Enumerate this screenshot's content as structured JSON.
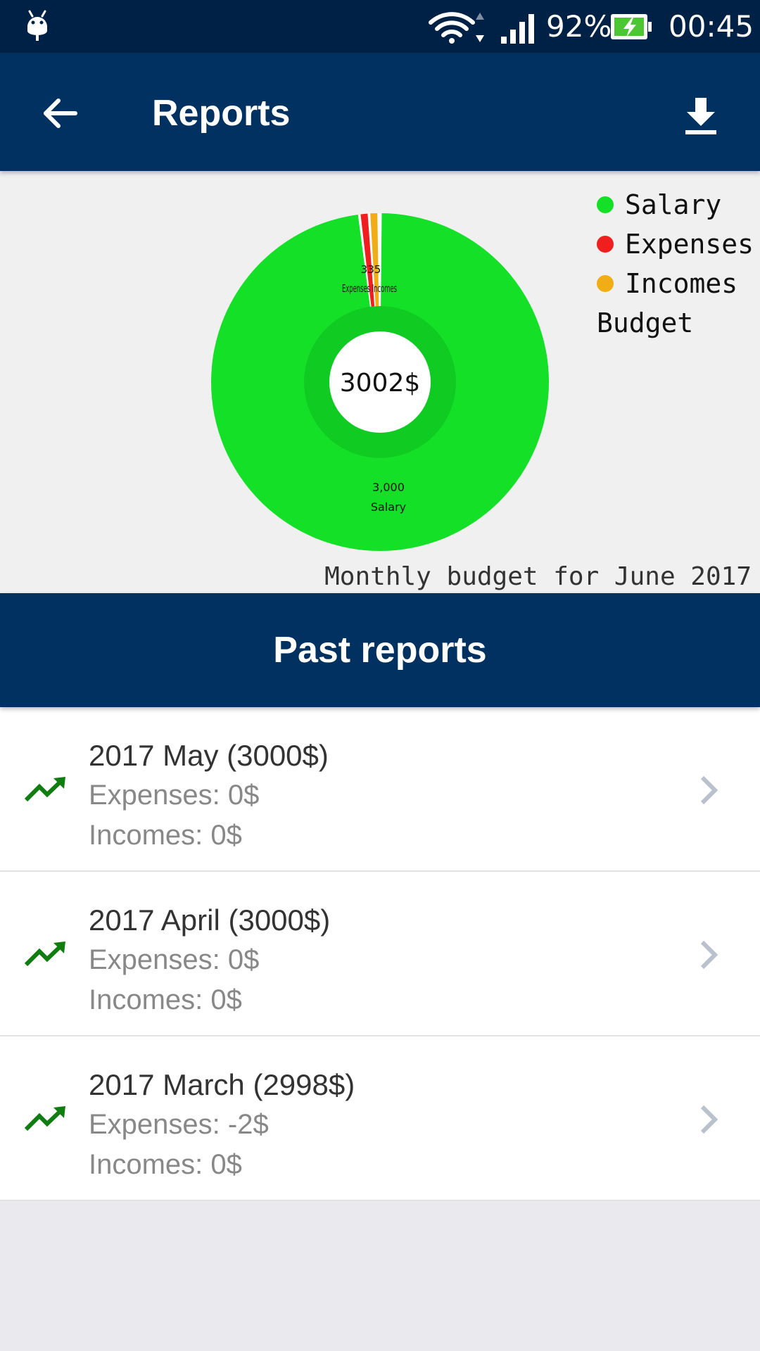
{
  "status_bar": {
    "battery_percent": "92%",
    "time": "00:45",
    "icons": [
      "android-icon",
      "wifi-icon",
      "signal-icon",
      "battery-charging-icon"
    ]
  },
  "app_bar": {
    "title": "Reports",
    "back_icon": "arrow-left-icon",
    "download_icon": "download-icon"
  },
  "chart": {
    "center_text": "3002$",
    "caption": "Monthly budget for June 2017",
    "legend": [
      {
        "label": "Salary",
        "color": "#13e027"
      },
      {
        "label": "Expenses",
        "color": "#f01e1e"
      },
      {
        "label": "Incomes",
        "color": "#f0ad15"
      }
    ],
    "inner_legend_label": "Budget",
    "salary_value_label": "3,000",
    "salary_name_label": "Salary",
    "small_values_label": "335",
    "small_names_label": "Expenses Incomes"
  },
  "chart_data": {
    "type": "pie",
    "categories": [
      "Salary",
      "Expenses",
      "Incomes"
    ],
    "values": [
      3000,
      3,
      5
    ],
    "inner_ring": {
      "label": "Budget",
      "value": 3002
    },
    "colors": [
      "#13e027",
      "#f01e1e",
      "#f0ad15"
    ],
    "title": "",
    "subtitle": "Monthly budget for June 2017",
    "legend_position": "top-right"
  },
  "past_reports": {
    "header": "Past reports",
    "items": [
      {
        "title": "2017 May (3000$)",
        "expenses": "Expenses: 0$",
        "incomes": "Incomes: 0$"
      },
      {
        "title": "2017 April (3000$)",
        "expenses": "Expenses: 0$",
        "incomes": "Incomes: 0$"
      },
      {
        "title": "2017 March (2998$)",
        "expenses": "Expenses: -2$",
        "incomes": "Incomes: 0$"
      }
    ]
  },
  "colors": {
    "status_bar": "#002146",
    "app_bar": "#003161",
    "trend_icon": "#0f7d10",
    "chevron": "#b9c1cc"
  }
}
